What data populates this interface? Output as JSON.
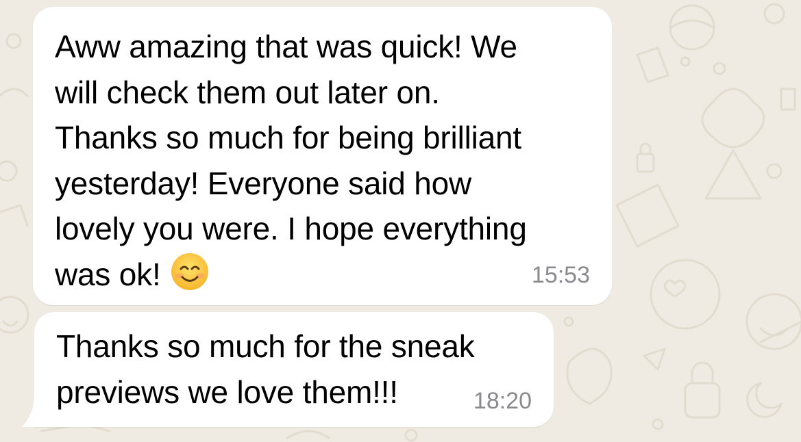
{
  "messages": [
    {
      "text": "Aww amazing that was quick! We\nwill check them out later on.\nThanks so much for being brilliant\nyesterday! Everyone said how\nlovely you were. I hope everything\nwas ok!",
      "emoji": "smiling-face-with-smiling-eyes",
      "time": "15:53"
    },
    {
      "text": "Thanks so much for the sneak\npreviews we love them!!!",
      "time": "18:20"
    }
  ],
  "colors": {
    "background": "#efeae2",
    "bubble": "#ffffff",
    "text": "#000000",
    "timestamp": "#8a8a8e",
    "doodle": "#e2dccf"
  }
}
